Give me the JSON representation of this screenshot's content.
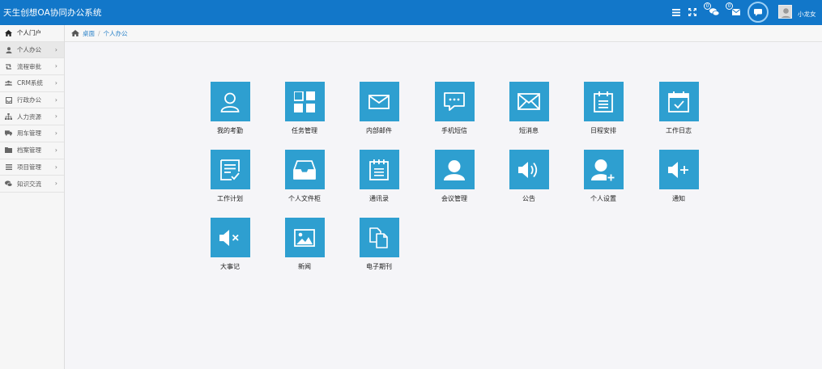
{
  "header": {
    "title": "天生创想OA协同办公系统",
    "msg_badge": "0",
    "mail_badge": "0",
    "user_name": "小龙女",
    "icons": [
      "menu-icon",
      "fullscreen-icon",
      "chat-bubbles-icon",
      "mail-icon",
      "chat-icon",
      "user-avatar"
    ]
  },
  "breadcrumb": {
    "home": "桌面",
    "sep": "/",
    "current": "个人办公"
  },
  "sidebar": {
    "items": [
      {
        "label": "个人门户",
        "icon": "home-icon"
      },
      {
        "label": "个人办公",
        "icon": "user-icon"
      },
      {
        "label": "流程审批",
        "icon": "retweet-icon"
      },
      {
        "label": "CRM系统",
        "icon": "users-icon"
      },
      {
        "label": "行政办公",
        "icon": "inbox-icon"
      },
      {
        "label": "人力资源",
        "icon": "sitemap-icon"
      },
      {
        "label": "用车管理",
        "icon": "truck-icon"
      },
      {
        "label": "档案管理",
        "icon": "folder-icon"
      },
      {
        "label": "项目管理",
        "icon": "list-icon"
      },
      {
        "label": "知识交流",
        "icon": "comments-icon"
      }
    ],
    "chevron": "›"
  },
  "apps": [
    {
      "label": "我的考勤",
      "icon": "user-outline-icon"
    },
    {
      "label": "任务管理",
      "icon": "grid-icon"
    },
    {
      "label": "内部邮件",
      "icon": "envelope-icon"
    },
    {
      "label": "手机短信",
      "icon": "sms-icon"
    },
    {
      "label": "短消息",
      "icon": "envelope-large-icon"
    },
    {
      "label": "日程安排",
      "icon": "schedule-icon"
    },
    {
      "label": "工作日志",
      "icon": "calendar-check-icon"
    },
    {
      "label": "工作计划",
      "icon": "plan-icon"
    },
    {
      "label": "个人文件柜",
      "icon": "inbox-tray-icon"
    },
    {
      "label": "通讯录",
      "icon": "notepad-icon"
    },
    {
      "label": "会议管理",
      "icon": "person-icon"
    },
    {
      "label": "公告",
      "icon": "volume-up-icon"
    },
    {
      "label": "个人设置",
      "icon": "person-add-icon"
    },
    {
      "label": "通知",
      "icon": "volume-plus-icon"
    },
    {
      "label": "大事记",
      "icon": "volume-off-icon"
    },
    {
      "label": "新闻",
      "icon": "image-icon"
    },
    {
      "label": "电子期刊",
      "icon": "files-icon"
    }
  ],
  "colors": {
    "header": "#1277c9",
    "tile": "#2e9fd0",
    "link": "#2c83c9"
  }
}
